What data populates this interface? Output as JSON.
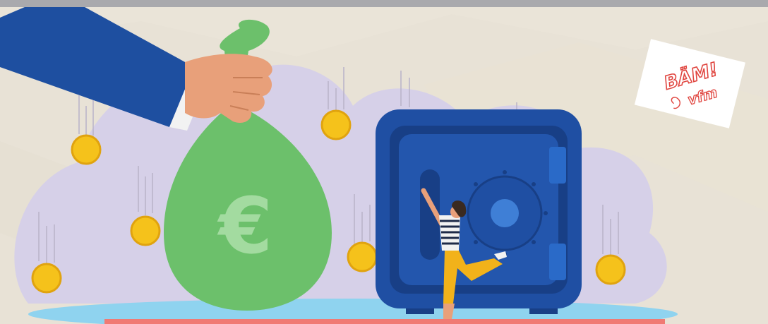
{
  "scene": {
    "description_free": true,
    "colors": {
      "background": "#e8e2d6",
      "top_bar": "#a9a9ad",
      "cloud": "#d6d0e8",
      "sleeve": "#1e4fa0",
      "skin": "#e8a07a",
      "bag": "#6cc06b",
      "bag_symbol": "#a3dba0",
      "safe": "#1f4fa3",
      "safe_dark": "#183f86",
      "coin": "#f5c21b",
      "pool": "#8fd3ef",
      "bottom_bar": "#f07a74",
      "accent_red": "#e0453f",
      "shirt_stripe": "#1e2a48",
      "pants": "#f2b21a"
    }
  },
  "money_bag": {
    "symbol": "€"
  },
  "logo": {
    "line1": "BÄM!",
    "line2": "vfm"
  },
  "icons": {
    "coin": "coin-icon",
    "safe": "safe-icon",
    "bag": "money-bag-icon",
    "hand": "hand-icon"
  }
}
